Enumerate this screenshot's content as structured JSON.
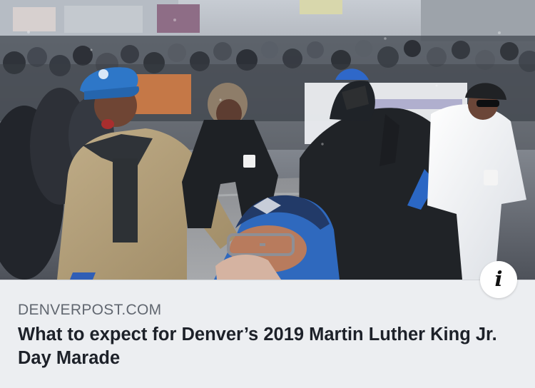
{
  "link_preview": {
    "domain": "DENVERPOST.COM",
    "headline": "What to expect for Denver’s 2019 Martin Luther King Jr. Day Marade",
    "info_glyph": "i"
  },
  "colors": {
    "background": "#eceef1",
    "domain_text": "#616770",
    "headline_text": "#1d2129",
    "info_button_bg": "#ffffff"
  }
}
